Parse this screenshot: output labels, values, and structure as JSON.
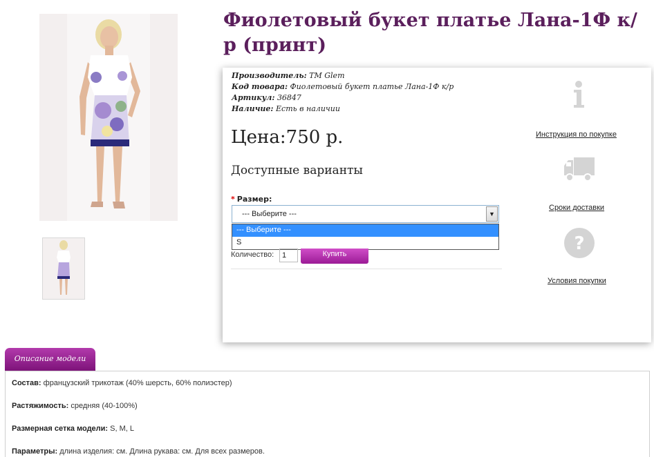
{
  "product": {
    "title": "Фиолетовый букет платье Лана-1Ф к/р (принт)"
  },
  "specs": {
    "manufacturer_label": "Производитель:",
    "manufacturer_value": "TM Glem",
    "code_label": "Код товара:",
    "code_value": "Фиолетовый букет платье Лана-1Ф к/р",
    "article_label": "Артикул:",
    "article_value": "36847",
    "stock_label": "Наличие:",
    "stock_value": "Есть в наличии"
  },
  "price": {
    "text": "Цена:750 р."
  },
  "options": {
    "heading": "Доступные варианты",
    "size_label": "Размер:",
    "required_mark": "*",
    "selected": "--- Выберите ---",
    "dropdown_options": [
      "--- Выберите ---",
      "S"
    ]
  },
  "purchase": {
    "quantity_label": "Количество:",
    "quantity_value": "1",
    "buy_label": "Купить"
  },
  "side_links": {
    "instruction": "Инструкция по покупке",
    "delivery": "Сроки доставки",
    "terms": "Условия покупки"
  },
  "tabs": {
    "description_tab": "Описание модели"
  },
  "description": {
    "composition_label": "Состав:",
    "composition_value": "французский трикотаж (40% шерсть, 60% полиэстер)",
    "stretch_label": "Растяжимость:",
    "stretch_value": "средняя (40-100%)",
    "sizes_label": "Размерная сетка модели:",
    "sizes_value": "S, M, L",
    "params_label": "Параметры:",
    "params_value": "длина изделия: см. Длина рукава: см. Для всех размеров."
  },
  "colors": {
    "title": "#5b1f5c",
    "accent": "#9b1b96",
    "select_highlight": "#3390ff",
    "icon_gray": "#d4d4d4"
  },
  "icons": {
    "info": "info-icon",
    "truck": "truck-icon",
    "question": "question-icon"
  }
}
